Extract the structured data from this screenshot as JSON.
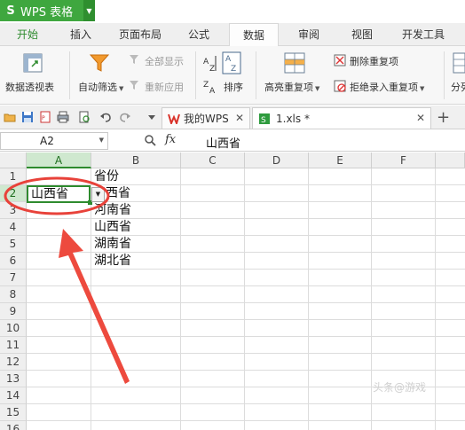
{
  "app": {
    "logo": "S",
    "title": "WPS 表格"
  },
  "tabs": [
    "开始",
    "插入",
    "页面布局",
    "公式",
    "数据",
    "审阅",
    "视图",
    "开发工具"
  ],
  "ribbon": {
    "pivot": "数据透视表",
    "autofilter": "自动筛选",
    "show_all": "全部显示",
    "reapply": "重新应用",
    "sort": "排序",
    "highlight_dup": "高亮重复项",
    "remove_dup": "删除重复项",
    "reject_dup": "拒绝录入重复项",
    "split": "分列"
  },
  "doc_tabs": {
    "wps": "我的WPS",
    "file": "1.xls *"
  },
  "formula_bar": {
    "name_box": "A2",
    "fx": "fx",
    "value": "山西省"
  },
  "columns": [
    "A",
    "B",
    "C",
    "D",
    "E",
    "F"
  ],
  "rows": [
    "1",
    "2",
    "3",
    "4",
    "5",
    "6",
    "7",
    "8",
    "9",
    "10",
    "11",
    "12",
    "13",
    "14",
    "15",
    "16"
  ],
  "cells": {
    "A2": "山西省",
    "B1": "省份",
    "B2": "西省",
    "B3": "河南省",
    "B4": "山西省",
    "B5": "湖南省",
    "B6": "湖北省"
  },
  "watermark": "头条@游戏",
  "colors": {
    "accent": "#2e8b2e",
    "annotation": "#e8423a"
  },
  "icons": {
    "save": "save-icon",
    "undo": "undo-icon",
    "redo": "redo-icon",
    "filter": "funnel-icon",
    "sort": "sort-icon",
    "zoom": "zoom-icon",
    "close": "close-icon",
    "add": "plus-icon"
  }
}
